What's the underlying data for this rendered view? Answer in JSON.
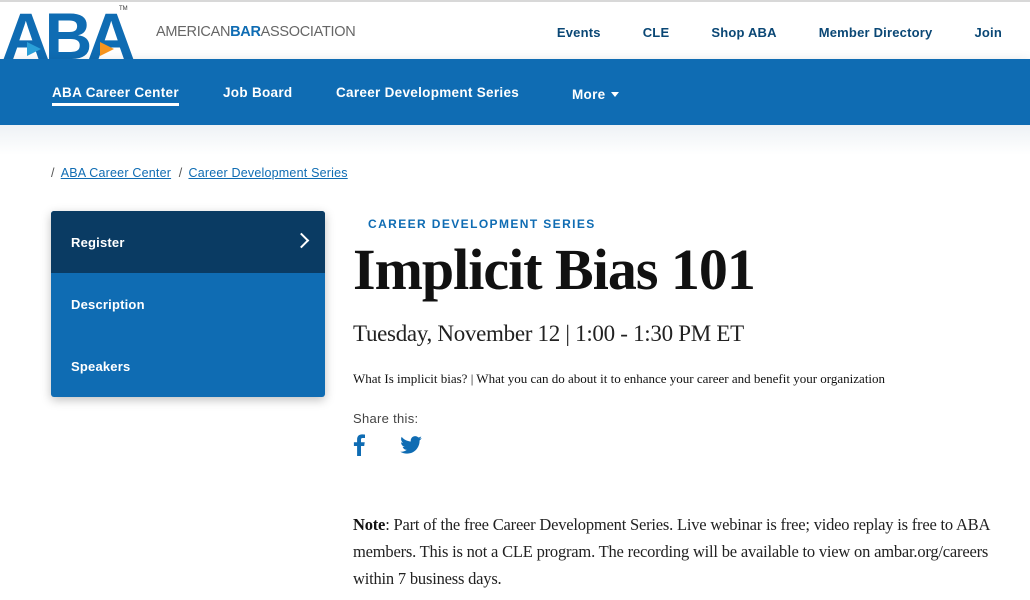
{
  "brand": {
    "logo_text": "ABA",
    "trademark": "TM",
    "wordmark_pre": "AMERICAN",
    "wordmark_bar": "BAR",
    "wordmark_post": "ASSOCIATION",
    "colors": {
      "primary": "#0f6cb3",
      "dark": "#0a3b63",
      "accent": "#f7941d"
    }
  },
  "top_nav": [
    "Events",
    "CLE",
    "Shop ABA",
    "Member Directory",
    "Join"
  ],
  "main_nav": {
    "items": [
      "ABA Career Center",
      "Job Board",
      "Career Development Series"
    ],
    "more": "More",
    "active": "ABA Career Center"
  },
  "breadcrumb": [
    "ABA Career Center",
    "Career Development Series"
  ],
  "side_menu": {
    "items": [
      "Register",
      "Description",
      "Speakers"
    ],
    "selected": "Register"
  },
  "event": {
    "kicker": "CAREER DEVELOPMENT SERIES",
    "title": "Implicit Bias 101",
    "datetime": "Tuesday, November 12 | 1:00 - 1:30 PM ET",
    "tagline": "What Is implicit bias? | What you can do about it to enhance your career and benefit your organization",
    "share_label": "Share this:",
    "share_icons": [
      "facebook-icon",
      "twitter-icon"
    ],
    "note_label": "Note",
    "note_text": ": Part of the free Career Development Series. Live webinar is free; video replay is free to ABA members. This is not a CLE program. The recording will be available to view on ambar.org/careers within 7 business days."
  }
}
